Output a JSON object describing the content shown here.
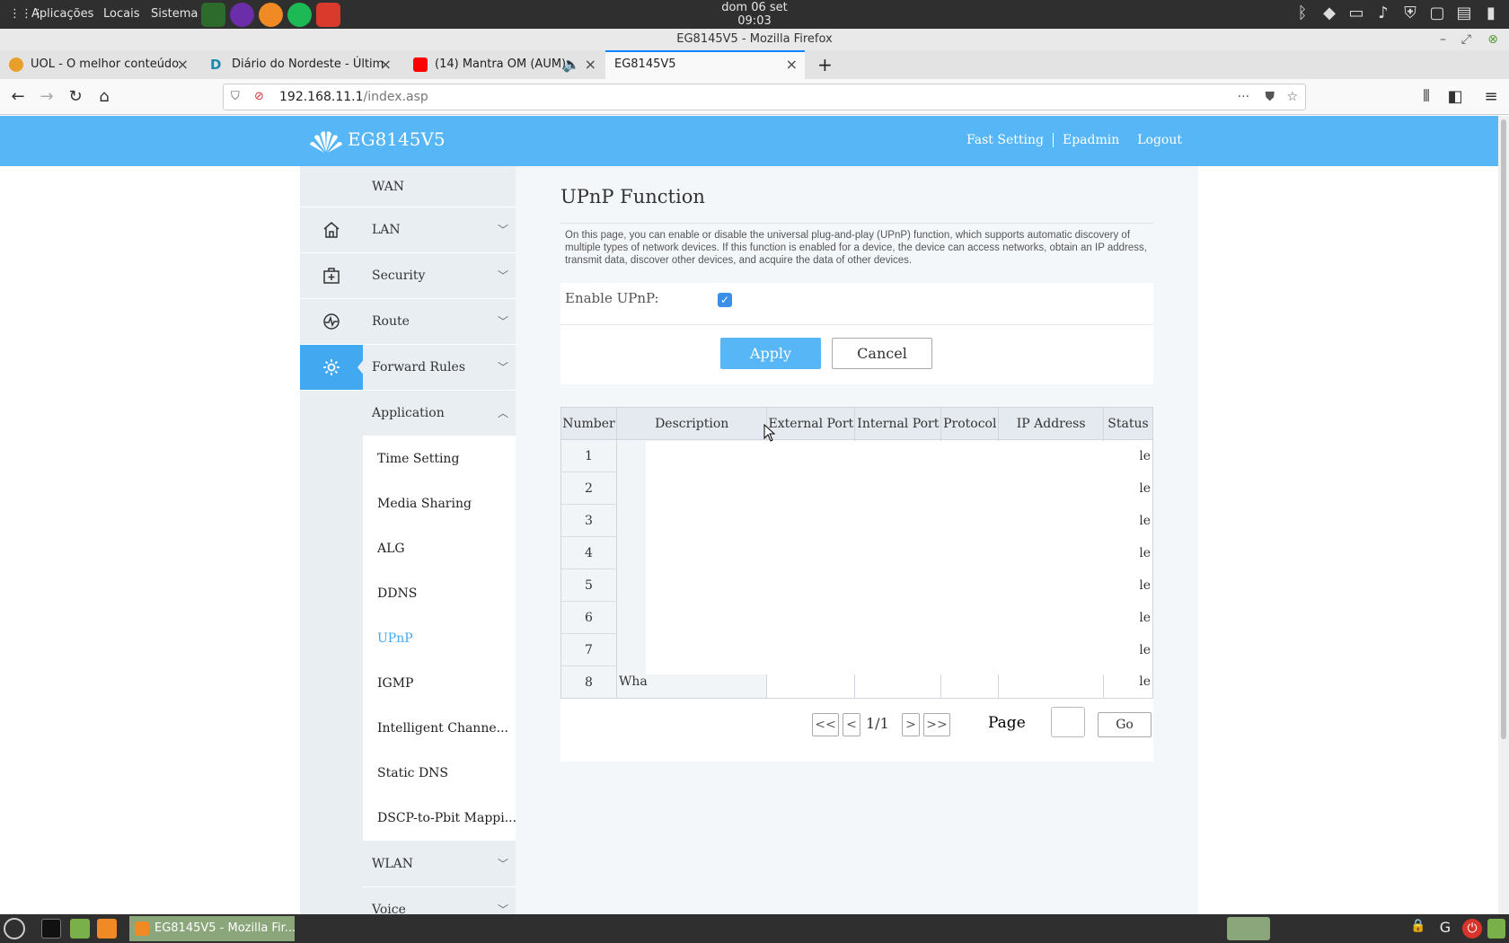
{
  "system_panel": {
    "menus": [
      "Aplicações",
      "Locais",
      "Sistema"
    ],
    "clock_date": "dom 06 set",
    "clock_time": "09:03"
  },
  "window": {
    "title": "EG8145V5 - Mozilla Firefox"
  },
  "tabs": [
    {
      "label": "UOL - O melhor conteúdo",
      "favicon_color": "#e8a02a"
    },
    {
      "label": "Diário do Nordeste - Últim",
      "favicon_color": "#1a8aa8"
    },
    {
      "label": "(14) Mantra OM (AUM) -",
      "favicon_color": "#ff0000"
    },
    {
      "label": "EG8145V5",
      "favicon_color": "#ffffff"
    }
  ],
  "url": {
    "host": "192.168.11.1",
    "path": "/index.asp"
  },
  "header": {
    "device_name": "EG8145V5",
    "links": [
      "Fast Setting",
      "Epadmin",
      "Logout"
    ],
    "brand_color": "#57b6f6"
  },
  "sidebar": {
    "menu": [
      {
        "label": "WAN"
      },
      {
        "label": "LAN"
      },
      {
        "label": "Security"
      },
      {
        "label": "Route"
      },
      {
        "label": "Forward Rules"
      },
      {
        "label": "Application"
      }
    ],
    "sub_items": [
      "Time Setting",
      "Media Sharing",
      "ALG",
      "DDNS",
      "UPnP",
      "IGMP",
      "Intelligent Channe...",
      "Static DNS",
      "DSCP-to-Pbit Mappi..."
    ],
    "active_sub": "UPnP",
    "menu_after": [
      {
        "label": "WLAN"
      },
      {
        "label": "Voice"
      }
    ],
    "icons": [
      "home-icon",
      "first-aid-icon",
      "diagnostic-icon",
      "gear-icon"
    ]
  },
  "main": {
    "title": "UPnP Function",
    "description": "On this page, you can enable or disable the universal plug-and-play (UPnP) function, which supports automatic discovery of multiple types of network devices. If this function is enabled for a device, the device can access networks, obtain an IP address, transmit data, discover other devices, and acquire the data of other devices.",
    "enable_label": "Enable UPnP:",
    "enable_checked": true,
    "apply_label": "Apply",
    "cancel_label": "Cancel",
    "table": {
      "columns": [
        "Number",
        "Description",
        "External Port",
        "Internal Port",
        "Protocol",
        "IP Address",
        "Status"
      ],
      "rows": [
        {
          "num": "1",
          "desc": "",
          "status": "le"
        },
        {
          "num": "2",
          "desc": "",
          "status": "le"
        },
        {
          "num": "3",
          "desc": "",
          "status": "le"
        },
        {
          "num": "4",
          "desc": "",
          "status": "le"
        },
        {
          "num": "5",
          "desc": "",
          "status": "le"
        },
        {
          "num": "6",
          "desc": "",
          "status": "le"
        },
        {
          "num": "7",
          "desc": "",
          "status": "le"
        },
        {
          "num": "8",
          "desc": "Wha",
          "status": "le"
        }
      ]
    },
    "pager": {
      "first": "<<",
      "prev": "<",
      "count": "1/1",
      "next": ">",
      "last": ">>",
      "page_label": "Page",
      "go_label": "Go"
    }
  },
  "taskbar": {
    "active_task": "EG8145V5 - Mozilla Fir..."
  }
}
